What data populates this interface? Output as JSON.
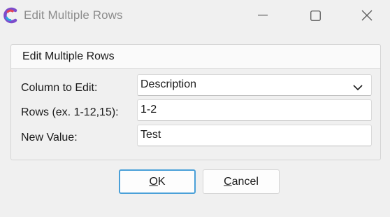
{
  "window": {
    "title": "Edit Multiple Rows",
    "controls": [
      "minimize-icon",
      "maximize-icon",
      "close-icon"
    ]
  },
  "group": {
    "title": "Edit Multiple Rows"
  },
  "form": {
    "column_label": "Column to Edit:",
    "column_value": "Description",
    "rows_label": "Rows (ex. 1-12,15):",
    "rows_value": "1-2",
    "new_value_label": "New Value:",
    "new_value_value": "Test"
  },
  "buttons": {
    "ok_mnemonic": "O",
    "ok_rest": "K",
    "cancel_mnemonic": "C",
    "cancel_rest": "ancel"
  },
  "colors": {
    "accent": "#4aa0d8",
    "title_text": "#8c8c8c"
  }
}
